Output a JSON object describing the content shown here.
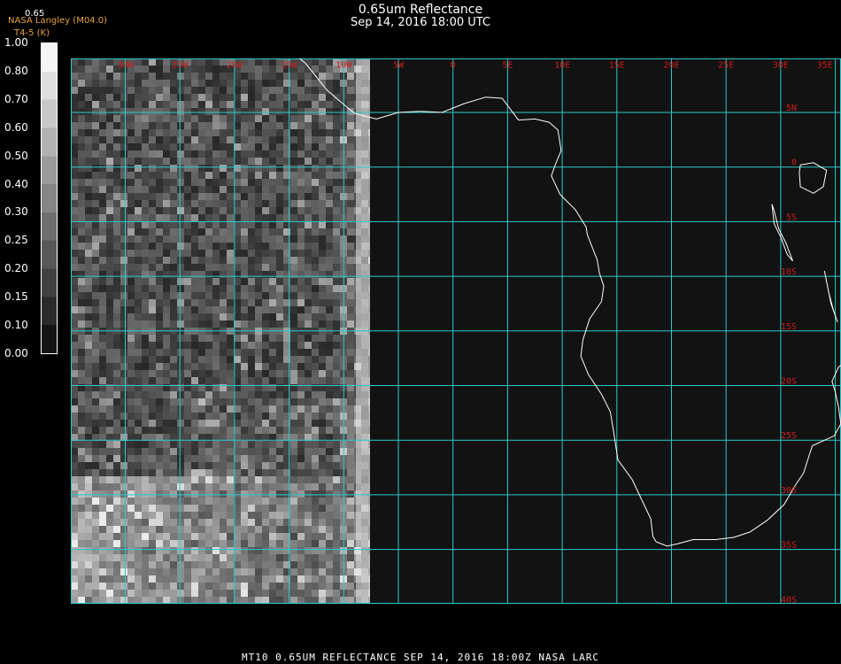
{
  "header": {
    "title": "0.65um Reflectance",
    "datetime": "Sep 14, 2016 18:00 UTC",
    "org_line1": "NASA Langley (M04.0)",
    "org_line2": "T4-5 (K)",
    "scale_header": "0.65"
  },
  "colorbar": {
    "labels": [
      "1.00",
      "0.80",
      "0.70",
      "0.60",
      "0.50",
      "0.40",
      "0.30",
      "0.25",
      "0.20",
      "0.15",
      "0.10",
      "0.00"
    ]
  },
  "map": {
    "lon_labels": [
      "30W",
      "25W",
      "20W",
      "15W",
      "10W",
      "5W",
      "0",
      "5E",
      "10E",
      "15E",
      "20E",
      "25E",
      "30E",
      "35E"
    ],
    "lat_labels": [
      "5N",
      "0",
      "5S",
      "10S",
      "15S",
      "20S",
      "25S",
      "30S",
      "35S",
      "40S"
    ],
    "grid_color": "#2ec9c9",
    "label_color": "#d01c1c",
    "coast_color": "#ffffff"
  },
  "footer": {
    "text": "MT10  0.65UM REFLECTANCE   SEP 14, 2016 18:00Z   NASA LARC"
  }
}
